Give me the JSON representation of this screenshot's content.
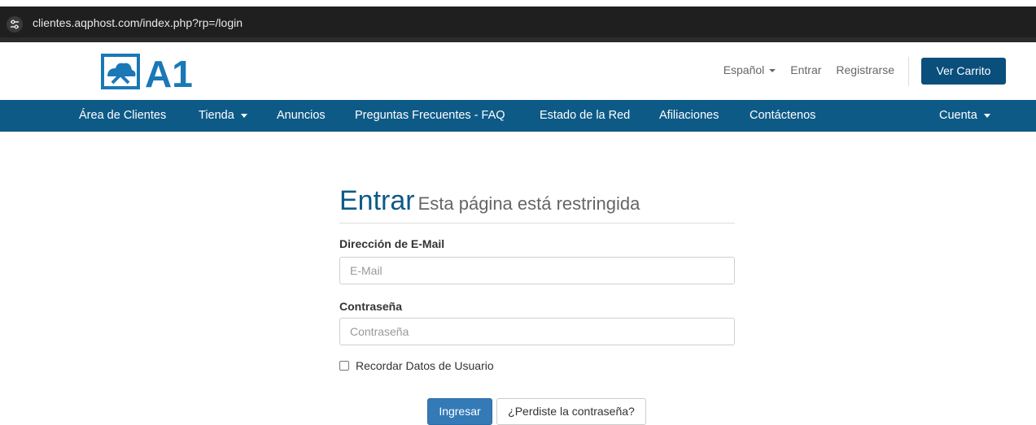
{
  "browser": {
    "url": "clientes.aqphost.com/index.php?rp=/login",
    "site_info_icon": "tune-icon"
  },
  "header": {
    "logo_text": "A1",
    "language": "Español",
    "login_link": "Entrar",
    "register_link": "Registrarse",
    "cart_button": "Ver Carrito"
  },
  "nav": {
    "items": [
      {
        "label": "Área de Clientes"
      },
      {
        "label": "Tienda"
      },
      {
        "label": "Anuncios"
      },
      {
        "label": "Preguntas Frecuentes - FAQ"
      },
      {
        "label": "Estado de la Red"
      },
      {
        "label": "Afiliaciones"
      },
      {
        "label": "Contáctenos"
      }
    ],
    "account": "Cuenta"
  },
  "login": {
    "title": "Entrar",
    "subtitle": "Esta página está restringida",
    "email_label": "Dirección de E-Mail",
    "email_placeholder": "E-Mail",
    "password_label": "Contraseña",
    "password_placeholder": "Contraseña",
    "remember_label": "Recordar Datos de Usuario",
    "submit_button": "Ingresar",
    "forgot_button": "¿Perdiste la contraseña?"
  },
  "colors": {
    "brand_blue": "#0e5a87",
    "button_blue": "#337ab7",
    "cart_blue": "#0a4e7c"
  }
}
